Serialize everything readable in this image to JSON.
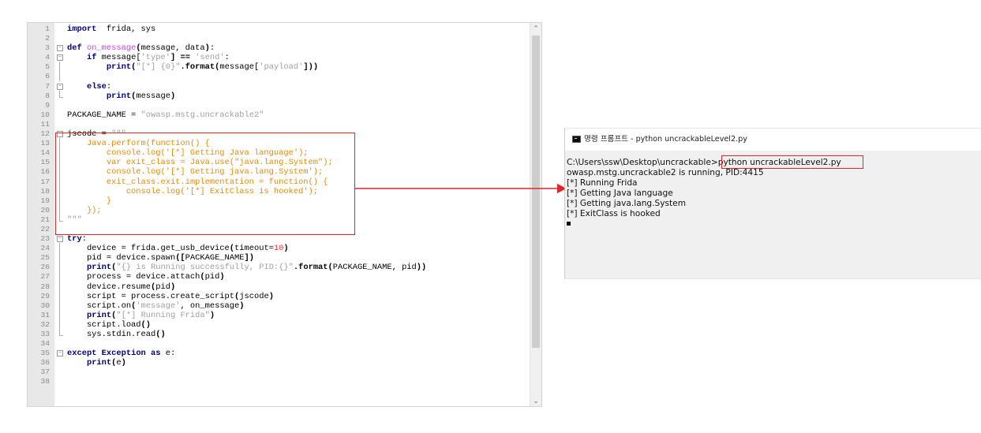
{
  "editor": {
    "lines": [
      {
        "n": "1",
        "segs": [
          [
            "kw",
            "import"
          ],
          [
            "",
            "  frida, sys"
          ]
        ]
      },
      {
        "n": "2",
        "segs": []
      },
      {
        "n": "3",
        "segs": [
          [
            "kw",
            "def "
          ],
          [
            "fn",
            "on_message"
          ],
          [
            "op",
            "("
          ],
          [
            "",
            "message, data"
          ],
          [
            "op",
            ")"
          ],
          [
            "",
            ":"
          ]
        ]
      },
      {
        "n": "4",
        "segs": [
          [
            "",
            "    "
          ],
          [
            "kw",
            "if"
          ],
          [
            "",
            " message["
          ],
          [
            "str",
            "'type'"
          ],
          [
            "",
            ""
          ],
          [
            "op",
            "] =="
          ],
          [
            "",
            ""
          ],
          [
            "str",
            " 'send'"
          ],
          [
            "",
            ":"
          ]
        ]
      },
      {
        "n": "5",
        "segs": [
          [
            "",
            "        "
          ],
          [
            "kw",
            "print"
          ],
          [
            "op",
            "("
          ],
          [
            "str",
            "\"[*] {0}\""
          ],
          [
            "",
            ""
          ],
          [
            "op",
            ".format"
          ],
          [
            "op",
            "("
          ],
          [
            "",
            "message["
          ],
          [
            "str",
            "'payload'"
          ],
          [
            "op",
            "]))"
          ]
        ]
      },
      {
        "n": "6",
        "segs": []
      },
      {
        "n": "7",
        "segs": [
          [
            "",
            "    "
          ],
          [
            "kw",
            "else"
          ],
          [
            "",
            ":"
          ]
        ]
      },
      {
        "n": "8",
        "segs": [
          [
            "",
            "        "
          ],
          [
            "kw",
            "print"
          ],
          [
            "op",
            "("
          ],
          [
            "",
            "message"
          ],
          [
            "op",
            ")"
          ]
        ]
      },
      {
        "n": "9",
        "segs": []
      },
      {
        "n": "10",
        "segs": [
          [
            "",
            "PACKAGE_NAME = "
          ],
          [
            "str",
            "\"owasp.mstg.uncrackable2\""
          ]
        ]
      },
      {
        "n": "11",
        "segs": []
      },
      {
        "n": "12",
        "segs": [
          [
            "",
            "jscode = "
          ],
          [
            "str",
            "\"\"\""
          ]
        ]
      },
      {
        "n": "13",
        "segs": [
          [
            "js",
            "    Java.perform(function() {"
          ]
        ]
      },
      {
        "n": "14",
        "segs": [
          [
            "js",
            "        console.log('[*] Getting Java language');"
          ]
        ]
      },
      {
        "n": "15",
        "segs": [
          [
            "js",
            "        var exit_class = Java.use(\"java.lang.System\");"
          ]
        ]
      },
      {
        "n": "16",
        "segs": [
          [
            "js",
            "        console.log('[*] Getting java.lang.System');"
          ]
        ]
      },
      {
        "n": "17",
        "segs": [
          [
            "js",
            "        exit_class.exit.implementation = function() {"
          ]
        ]
      },
      {
        "n": "18",
        "segs": [
          [
            "js",
            "            console.log('[*] ExitClass is hooked');"
          ]
        ]
      },
      {
        "n": "19",
        "segs": [
          [
            "js",
            "        }"
          ]
        ]
      },
      {
        "n": "20",
        "segs": [
          [
            "js",
            "    });"
          ]
        ]
      },
      {
        "n": "21",
        "segs": [
          [
            "str",
            "\"\"\""
          ]
        ]
      },
      {
        "n": "22",
        "segs": []
      },
      {
        "n": "23",
        "segs": [
          [
            "kw",
            "try"
          ],
          [
            "",
            ":"
          ]
        ]
      },
      {
        "n": "24",
        "segs": [
          [
            "",
            "    device = frida.get_usb_device"
          ],
          [
            "op",
            "("
          ],
          [
            "",
            "timeout="
          ],
          [
            "num",
            "10"
          ],
          [
            "op",
            ")"
          ]
        ]
      },
      {
        "n": "25",
        "segs": [
          [
            "",
            "    pid = device.spawn"
          ],
          [
            "op",
            "(["
          ],
          [
            "",
            "PACKAGE_NAME"
          ],
          [
            "op",
            "])"
          ]
        ]
      },
      {
        "n": "26",
        "segs": [
          [
            "",
            "    "
          ],
          [
            "kw",
            "print"
          ],
          [
            "op",
            "("
          ],
          [
            "str",
            "\"{} is Running successfully, PID:{}\""
          ],
          [
            "op",
            ".format"
          ],
          [
            "op",
            "("
          ],
          [
            "",
            "PACKAGE_NAME, pid"
          ],
          [
            "op",
            "))"
          ]
        ]
      },
      {
        "n": "27",
        "segs": [
          [
            "",
            "    process = device.attach"
          ],
          [
            "op",
            "("
          ],
          [
            "",
            "pid"
          ],
          [
            "op",
            ")"
          ]
        ]
      },
      {
        "n": "28",
        "segs": [
          [
            "",
            "    device.resume"
          ],
          [
            "op",
            "("
          ],
          [
            "",
            "pid"
          ],
          [
            "op",
            ")"
          ]
        ]
      },
      {
        "n": "29",
        "segs": [
          [
            "",
            "    script = process.create_script"
          ],
          [
            "op",
            "("
          ],
          [
            "",
            "jscode"
          ],
          [
            "op",
            ")"
          ]
        ]
      },
      {
        "n": "30",
        "segs": [
          [
            "",
            "    script.on"
          ],
          [
            "op",
            "("
          ],
          [
            "str",
            "'message'"
          ],
          [
            "",
            ", on_message"
          ],
          [
            "op",
            ")"
          ]
        ]
      },
      {
        "n": "31",
        "segs": [
          [
            "",
            "    "
          ],
          [
            "kw",
            "print"
          ],
          [
            "op",
            "("
          ],
          [
            "str",
            "\"[*] Running Frida\""
          ],
          [
            "op",
            ")"
          ]
        ]
      },
      {
        "n": "32",
        "segs": [
          [
            "",
            "    script.load"
          ],
          [
            "op",
            "()"
          ]
        ]
      },
      {
        "n": "33",
        "segs": [
          [
            "",
            "    sys.stdin.read"
          ],
          [
            "op",
            "()"
          ]
        ]
      },
      {
        "n": "34",
        "segs": []
      },
      {
        "n": "35",
        "segs": [
          [
            "kw",
            "except"
          ],
          [
            "",
            " "
          ],
          [
            "kw",
            "Exception"
          ],
          [
            "",
            " "
          ],
          [
            "kw",
            "as"
          ],
          [
            "",
            " e:"
          ]
        ]
      },
      {
        "n": "36",
        "segs": [
          [
            "",
            "    "
          ],
          [
            "kw",
            "print"
          ],
          [
            "op",
            "("
          ],
          [
            "",
            "e"
          ],
          [
            "op",
            ")"
          ]
        ]
      },
      {
        "n": "37",
        "segs": []
      },
      {
        "n": "38",
        "segs": []
      }
    ],
    "folds": {
      "3": "box-minus",
      "4": "box-minus",
      "5": "vline",
      "6": "vline",
      "7": "box-minus",
      "8": "end",
      "12": "box-minus",
      "13": "vline",
      "14": "vline",
      "15": "vline",
      "16": "vline",
      "17": "vline",
      "18": "vline",
      "19": "vline",
      "20": "vline",
      "21": "end",
      "23": "box-minus",
      "24": "vline",
      "25": "vline",
      "26": "vline",
      "27": "vline",
      "28": "vline",
      "29": "vline",
      "30": "vline",
      "31": "vline",
      "32": "vline",
      "33": "end",
      "35": "box-minus"
    },
    "scroll_up_icon": "chevron-up-icon",
    "scroll_down_icon": "chevron-down-icon"
  },
  "terminal": {
    "title": "명령 프롬프트 - python  uncrackableLevel2.py",
    "lines": [
      "C:\\Users\\ssw\\Desktop\\uncrackable>python uncrackableLevel2.py",
      "owasp.mstg.uncrackable2 is running, PID:4415",
      "[*] Running Frida",
      "[*] Getting Java language",
      "[*] Getting java.lang.System",
      "[*] ExitClass is hooked"
    ]
  },
  "colors": {
    "keyword": "#00007f",
    "function_name": "#d23cff",
    "string": "#a0a0a0",
    "javascript": "#e88a00",
    "number": "#ff3030",
    "highlight": "#e1262a"
  }
}
